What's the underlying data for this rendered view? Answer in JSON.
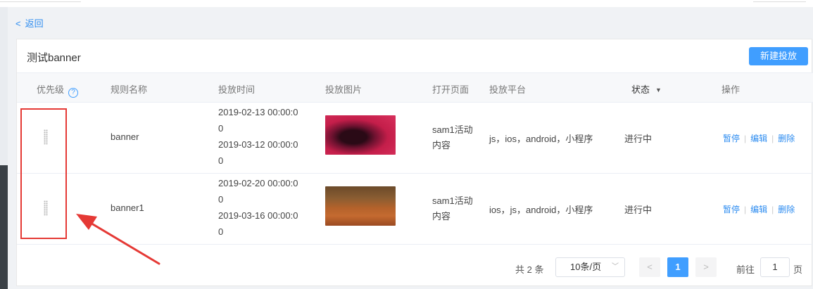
{
  "nav": {
    "back_label": "返回",
    "back_chevron": "<"
  },
  "card": {
    "title": "测试banner",
    "new_button": "新建投放"
  },
  "table": {
    "headers": {
      "priority": "优先级",
      "help_icon": "?",
      "rule_name": "规则名称",
      "time": "投放时间",
      "image": "投放图片",
      "open_page": "打开页面",
      "platform": "投放平台",
      "status": "状态",
      "status_caret": "▼",
      "actions": "操作"
    },
    "rows": [
      {
        "name": "banner",
        "start": "2019-02-13 00:00:0",
        "start_tail": "0",
        "end": "2019-03-12 00:00:0",
        "end_tail": "0",
        "image_icon": "red-anime-thumbnail",
        "page": "sam1活动内容",
        "platform": "js，ios，android，小程序",
        "status": "进行中"
      },
      {
        "name": "banner1",
        "start": "2019-02-20 00:00:0",
        "start_tail": "0",
        "end": "2019-03-16 00:00:0",
        "end_tail": "0",
        "image_icon": "autumn-road-thumbnail",
        "page": "sam1活动内容",
        "platform": "ios，js，android，小程序",
        "status": "进行中"
      }
    ],
    "actions": {
      "pause": "暂停",
      "edit": "编辑",
      "delete": "删除",
      "sep": "|"
    }
  },
  "pagination": {
    "total": "共 2 条",
    "page_size": "10条/页",
    "prev": "<",
    "current": "1",
    "next": ">",
    "goto_label": "前往",
    "goto_value": "1",
    "goto_suffix": "页"
  },
  "colors": {
    "primary": "#409eff",
    "link": "#2d8cf0",
    "annotation": "#e53935"
  }
}
